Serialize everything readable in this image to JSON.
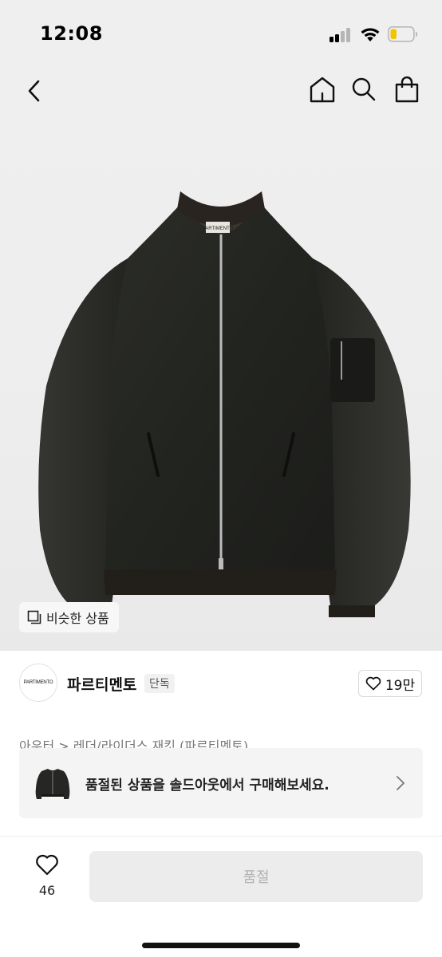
{
  "status_bar": {
    "time": "12:08",
    "signal_icon": "cellular-signal-icon",
    "wifi_icon": "wifi-icon",
    "battery_icon": "battery-low-icon",
    "battery_color": "#f2c400"
  },
  "header": {
    "back_icon": "chevron-left-icon",
    "home_icon": "home-icon",
    "search_icon": "search-icon",
    "bag_icon": "shopping-bag-icon"
  },
  "product": {
    "image_label": "PARTIMENTO",
    "similar_button": {
      "icon": "similar-items-icon",
      "label": "비슷한 상품"
    }
  },
  "brand": {
    "logo_text": "PARTIMENTO",
    "name": "파르티멘토",
    "tag": "단독",
    "likes": {
      "icon": "heart-outline-icon",
      "count": "19만"
    }
  },
  "breadcrumb": {
    "text": "아우터 > 레더/라이더스 재킷 (파르티멘토)"
  },
  "soldout_banner": {
    "text": "품절된 상품을 솔드아웃에서 구매해보세요.",
    "chevron_icon": "chevron-right-icon"
  },
  "bottom_bar": {
    "wish": {
      "icon": "heart-outline-icon",
      "count": "46"
    },
    "buy_button_label": "품절",
    "buy_button_color": "#ececec"
  }
}
